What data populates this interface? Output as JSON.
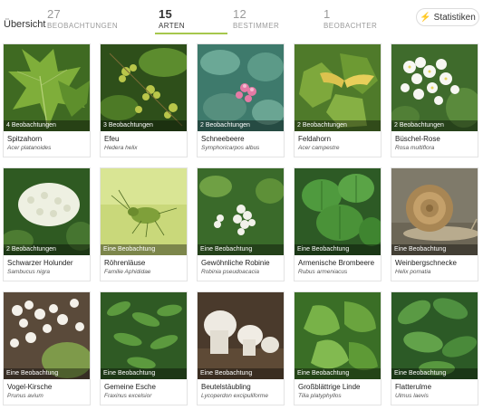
{
  "nav": {
    "overview_label": "Übersicht",
    "tabs": [
      {
        "count": "27",
        "label": "BEOBACHTUNGEN",
        "active": false
      },
      {
        "count": "15",
        "label": "ARTEN",
        "active": true
      },
      {
        "count": "12",
        "label": "BESTIMMER",
        "active": false
      },
      {
        "count": "1",
        "label": "BEOBACHTER",
        "active": false
      }
    ],
    "stats_label": "Statistiken",
    "accent": "#a6c74d"
  },
  "species": [
    {
      "name": "Spitzahorn",
      "latin": "Acer platanoides",
      "observations": "4 Beobachtungen",
      "icon": "maple-leaf-photo"
    },
    {
      "name": "Efeu",
      "latin": "Hedera helix",
      "observations": "3 Beobachtungen",
      "icon": "ivy-photo"
    },
    {
      "name": "Schneebeere",
      "latin": "Symphoricarpos albus",
      "observations": "2 Beobachtungen",
      "icon": "snowberry-photo"
    },
    {
      "name": "Feldahorn",
      "latin": "Acer campestre",
      "observations": "2 Beobachtungen",
      "icon": "field-maple-photo"
    },
    {
      "name": "Büschel-Rose",
      "latin": "Rosa multiflora",
      "observations": "2 Beobachtungen",
      "icon": "rose-photo"
    },
    {
      "name": "Schwarzer Holunder",
      "latin": "Sambucus nigra",
      "observations": "2 Beobachtungen",
      "icon": "elder-photo"
    },
    {
      "name": "Röhrenläuse",
      "latin": "Familie Aphididae",
      "observations": "Eine Beobachtung",
      "icon": "aphid-photo"
    },
    {
      "name": "Gewöhnliche Robinie",
      "latin": "Robinia pseudoacacia",
      "observations": "Eine Beobachtung",
      "icon": "robinia-photo"
    },
    {
      "name": "Armenische Brombeere",
      "latin": "Rubus armeniacus",
      "observations": "Eine Beobachtung",
      "icon": "blackberry-photo"
    },
    {
      "name": "Weinbergschnecke",
      "latin": "Helix pomatia",
      "observations": "Eine Beobachtung",
      "icon": "snail-photo"
    },
    {
      "name": "Vogel-Kirsche",
      "latin": "Prunus avium",
      "observations": "Eine Beobachtung",
      "icon": "cherry-photo"
    },
    {
      "name": "Gemeine Esche",
      "latin": "Fraxinus excelsior",
      "observations": "Eine Beobachtung",
      "icon": "ash-photo"
    },
    {
      "name": "Beutelstäubling",
      "latin": "Lycoperdon excipuliforme",
      "observations": "Eine Beobachtung",
      "icon": "puffball-photo"
    },
    {
      "name": "Großblättrige Linde",
      "latin": "Tilia platyphyllos",
      "observations": "Eine Beobachtung",
      "icon": "linden-photo"
    },
    {
      "name": "Flatterulme",
      "latin": "Ulmus laevis",
      "observations": "Eine Beobachtung",
      "icon": "elm-photo"
    }
  ]
}
